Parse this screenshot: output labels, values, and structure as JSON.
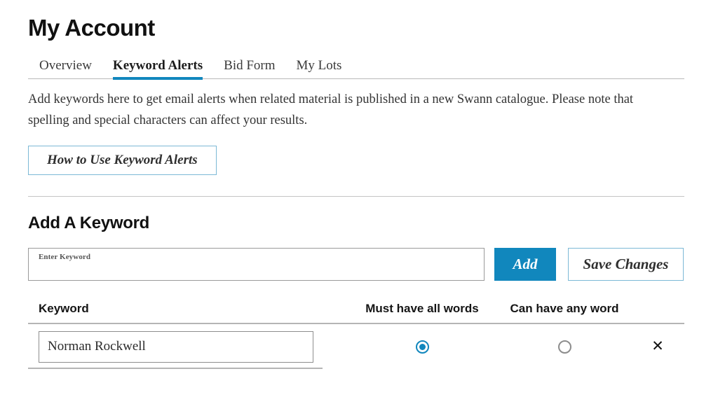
{
  "page": {
    "title": "My Account"
  },
  "tabs": [
    {
      "label": "Overview",
      "active": false
    },
    {
      "label": "Keyword Alerts",
      "active": true
    },
    {
      "label": "Bid Form",
      "active": false
    },
    {
      "label": "My Lots",
      "active": false
    }
  ],
  "intro": {
    "text": "Add keywords here to get email alerts when related material is published in a new Swann catalogue. Please note that spelling and special characters can affect your results."
  },
  "howto_button": {
    "label": "How to Use Keyword Alerts"
  },
  "add_section": {
    "heading": "Add A Keyword",
    "input_label": "Enter Keyword",
    "input_value": "",
    "input_placeholder": "",
    "add_label": "Add",
    "save_label": "Save Changes"
  },
  "table": {
    "headers": {
      "keyword": "Keyword",
      "must_all": "Must have all words",
      "can_any": "Can have any word"
    },
    "rows": [
      {
        "keyword": "Norman Rockwell",
        "must_have_all_words": true,
        "can_have_any_word": false,
        "delete_icon": "✕"
      }
    ]
  },
  "colors": {
    "accent_blue": "#1187bd",
    "ghost_border_blue": "#7cb9d6",
    "rule_gray": "#b5b5b5",
    "text_dark": "#2b2b2b"
  }
}
